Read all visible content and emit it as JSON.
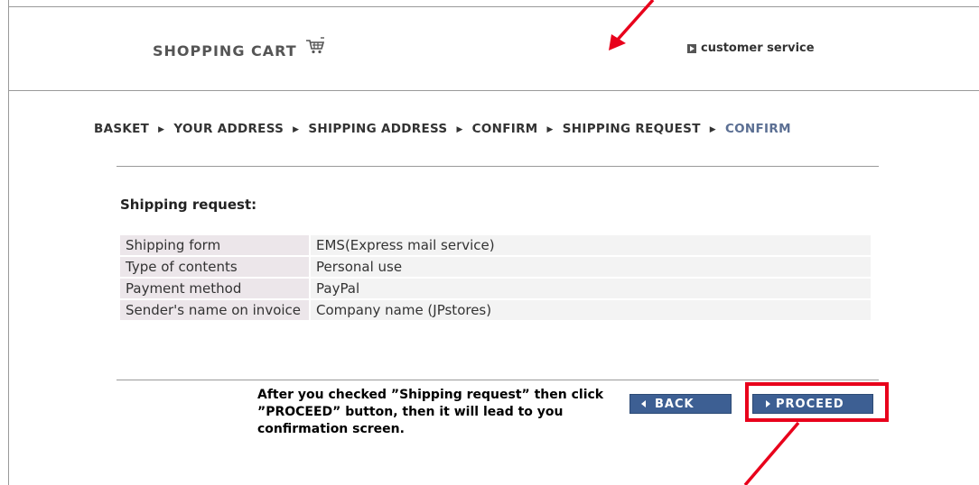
{
  "header": {
    "brand": "SHOPPING CART",
    "customer_service": "customer service"
  },
  "breadcrumb": {
    "steps": [
      "BASKET",
      "YOUR ADDRESS",
      "SHIPPING ADDRESS",
      "CONFIRM",
      "SHIPPING REQUEST",
      "CONFIRM"
    ],
    "current_index": 5
  },
  "section": {
    "title": "Shipping request:",
    "rows": [
      {
        "label": "Shipping form",
        "value": "EMS(Express mail service)"
      },
      {
        "label": "Type of contents",
        "value": "Personal use"
      },
      {
        "label": "Payment method",
        "value": "PayPal"
      },
      {
        "label": "Sender's name on invoice",
        "value": "Company name (JPstores)"
      }
    ]
  },
  "buttons": {
    "back": "BACK",
    "proceed": "PROCEED"
  },
  "annotation": {
    "note": "After you checked ”Shipping request” then click ”PROCEED” button, then it will lead to you confirmation screen.",
    "color": "#e8001b"
  },
  "colors": {
    "button": "#3d5f93",
    "breadcrumb_current": "#5b6f93",
    "label_cell": "#ece6ea",
    "value_cell": "#f3f3f3"
  }
}
